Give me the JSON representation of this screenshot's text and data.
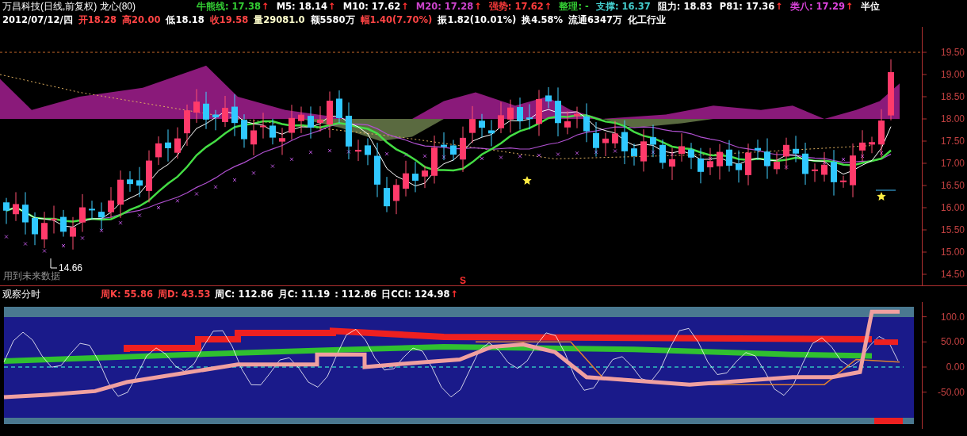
{
  "header": {
    "title": "万昌科技(日线,前复权) 龙心(80)",
    "indicators": [
      {
        "text": "牛熊线: 17.38",
        "arrow": "↑",
        "color": "#33cc33"
      },
      {
        "text": "M5: 18.14",
        "arrow": "↑",
        "color": "#ffffff"
      },
      {
        "text": "M10: 17.62",
        "arrow": "↑",
        "color": "#ffffff"
      },
      {
        "text": "M20: 17.28",
        "arrow": "↑",
        "color": "#cc44cc"
      },
      {
        "text": "强势: 17.62",
        "arrow": "↑",
        "color": "#ff3c3c"
      },
      {
        "text": "整理: -",
        "color": "#33cc33"
      },
      {
        "text": "支撑: 16.37",
        "color": "#44cccc"
      },
      {
        "text": "阻力: 18.83",
        "color": "#ffffff"
      },
      {
        "text": "P81: 17.36",
        "arrow": "↑",
        "color": "#ffffff"
      },
      {
        "text": "类八: 17.29",
        "arrow": "↑",
        "color": "#dd44dd"
      },
      {
        "text": "半位",
        "color": "#ffffff"
      }
    ],
    "quote": [
      {
        "text": "2012/07/12/四",
        "color": "#ffffff"
      },
      {
        "text": "开18.28",
        "color": "#ff4444"
      },
      {
        "text": "高20.00",
        "color": "#ff4444"
      },
      {
        "text": "低18.18",
        "color": "#ffffff"
      },
      {
        "text": "收19.58",
        "color": "#ff4444"
      },
      {
        "text": "量29081.0",
        "color": "#ffffcc"
      },
      {
        "text": "额5580万",
        "color": "#ffffff"
      },
      {
        "text": "幅1.40(7.70%)",
        "color": "#ff4444"
      },
      {
        "text": "振1.82(10.01%)",
        "color": "#ffffff"
      },
      {
        "text": "换4.58%",
        "color": "#ffffff"
      },
      {
        "text": "流通6347万",
        "color": "#ffffff"
      },
      {
        "text": "化工行业",
        "color": "#ffffff"
      }
    ]
  },
  "price_chart": {
    "yticks": [
      "19.50",
      "19.00",
      "18.50",
      "18.00",
      "17.50",
      "17.00",
      "16.50",
      "16.00",
      "15.50",
      "15.00",
      "14.50"
    ],
    "low_label": "14.66",
    "warning": "用到未来数据",
    "signal_marker": "S"
  },
  "indicator_panel": {
    "title": "观察分时",
    "values": [
      {
        "text": "周K: 55.86",
        "color": "#ff4444"
      },
      {
        "text": "周D: 43.53",
        "color": "#ff4444"
      },
      {
        "text": "周C: 112.86",
        "color": "#ffffff"
      },
      {
        "text": "月C: 11.19",
        "color": "#ffffff"
      },
      {
        "text": ": 112.86",
        "color": "#ffffff"
      },
      {
        "text": "日CCI: 124.98",
        "arrow": "↑",
        "color": "#ffffff"
      }
    ],
    "yticks": [
      "100.0",
      "50.00",
      "0.00",
      "-50.00"
    ]
  }
}
